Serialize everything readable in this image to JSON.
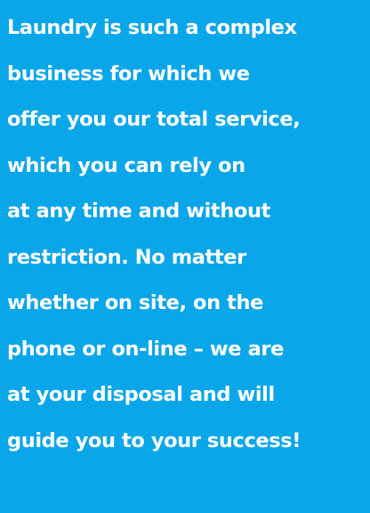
{
  "theme": {
    "background": "#0aa6ea",
    "text": "#ffffff"
  },
  "text_block": {
    "lines": [
      "Laundry is such a complex",
      "business for which we",
      "offer you our total service,",
      "which you can rely on",
      "at any time and without",
      "restriction. No matter",
      "whether on site, on the",
      "phone or on-line – we are",
      "at your disposal and will",
      "guide you to your success!"
    ]
  }
}
